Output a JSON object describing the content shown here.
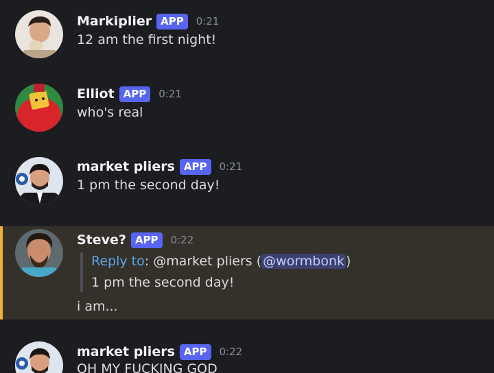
{
  "messages": [
    {
      "author": "Markiplier",
      "badge": "APP",
      "time": "0:21",
      "text": "12 am the first night!"
    },
    {
      "author": "Elliot",
      "badge": "APP",
      "time": "0:21",
      "text": "who's real"
    },
    {
      "author": "market pliers",
      "badge": "APP",
      "time": "0:21",
      "text": "1 pm the second day!"
    },
    {
      "author": "Steve?",
      "badge": "APP",
      "time": "0:22",
      "reply": {
        "label": "Reply to",
        "sep": ": ",
        "target": "@market pliers",
        "open_paren": " (",
        "mention": "@wormbonk",
        "close_paren": ")",
        "quoted_text": "1 pm the second day!"
      },
      "text": "i am..."
    },
    {
      "author": "market pliers",
      "badge": "APP",
      "time": "0:22",
      "text": "OH MY FUCKING GOD"
    }
  ],
  "colors": {
    "background": "#1c1d21",
    "highlight_bg": "#34302a",
    "highlight_border": "#f0b232",
    "badge": "#5865f2",
    "reply_label": "#5aa8e8",
    "mention_bg": "#3c4270"
  }
}
